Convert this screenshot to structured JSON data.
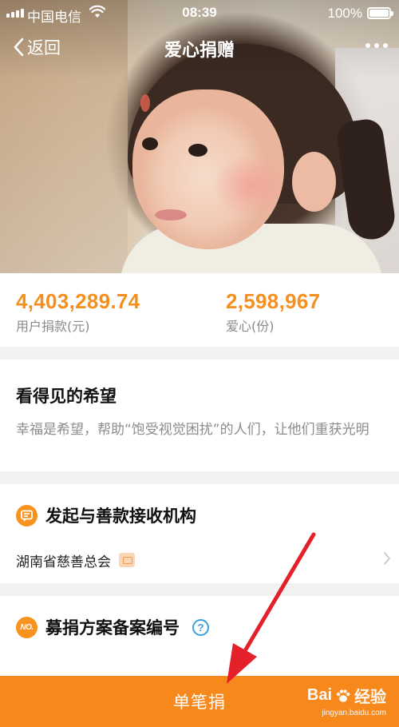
{
  "status_bar": {
    "carrier": "中国电信",
    "time": "08:39",
    "battery": "100%",
    "battery_level": 1.0
  },
  "nav": {
    "back_label": "返回",
    "title": "爱心捐赠",
    "more_icon": "more-dots-icon"
  },
  "stats": {
    "donation_amount": "4,403,289.74",
    "donation_label": "用户捐款(元)",
    "love_count": "2,598,967",
    "love_label": "爱心(份)"
  },
  "project": {
    "title": "看得见的希望",
    "description": "幸福是希望，帮助“饱受视觉困扰”的人们，让他们重获光明"
  },
  "organization": {
    "section_title": "发起与善款接收机构",
    "name": "湖南省慈善总会"
  },
  "filing": {
    "badge": "NO.",
    "section_title": "募捐方案备案编号",
    "help_glyph": "?"
  },
  "donate": {
    "button_label": "单笔捐"
  },
  "watermark": {
    "brand": "Bai",
    "brand_suffix": "经验",
    "url": "jingyan.baidu.com"
  },
  "colors": {
    "accent": "#f7881c",
    "amount": "#f5901e",
    "help": "#3aa0e0",
    "annotation_arrow": "#e4202a"
  }
}
